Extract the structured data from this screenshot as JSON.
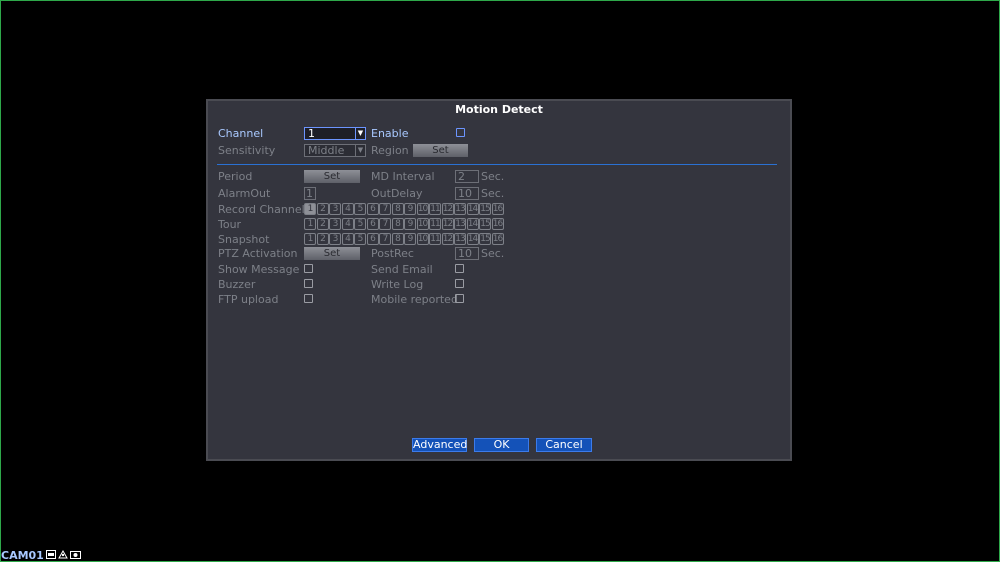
{
  "dialog": {
    "title": "Motion Detect",
    "channel_label": "Channel",
    "channel_value": "1",
    "enable_label": "Enable",
    "sensitivity_label": "Sensitivity",
    "sensitivity_value": "Middle",
    "region_label": "Region",
    "set_label": "Set",
    "period_label": "Period",
    "md_interval_label": "MD Interval",
    "md_interval_value": "2",
    "sec_label": "Sec.",
    "alarmout_label": "AlarmOut",
    "alarmout_value": "1",
    "outdelay_label": "OutDelay",
    "outdelay_value": "10",
    "record_channel_label": "Record Channel",
    "tour_label": "Tour",
    "snapshot_label": "Snapshot",
    "channels": [
      "1",
      "2",
      "3",
      "4",
      "5",
      "6",
      "7",
      "8",
      "9",
      "10",
      "11",
      "12",
      "13",
      "14",
      "15",
      "16"
    ],
    "ptz_label": "PTZ Activation",
    "postrec_label": "PostRec",
    "postrec_value": "10",
    "show_message_label": "Show Message",
    "send_email_label": "Send Email",
    "buzzer_label": "Buzzer",
    "write_log_label": "Write Log",
    "ftp_upload_label": "FTP upload",
    "mobile_reported_label": "Mobile reported",
    "advanced_label": "Advanced",
    "ok_label": "OK",
    "cancel_label": "Cancel"
  },
  "status": {
    "camera_label": "CAM01"
  }
}
